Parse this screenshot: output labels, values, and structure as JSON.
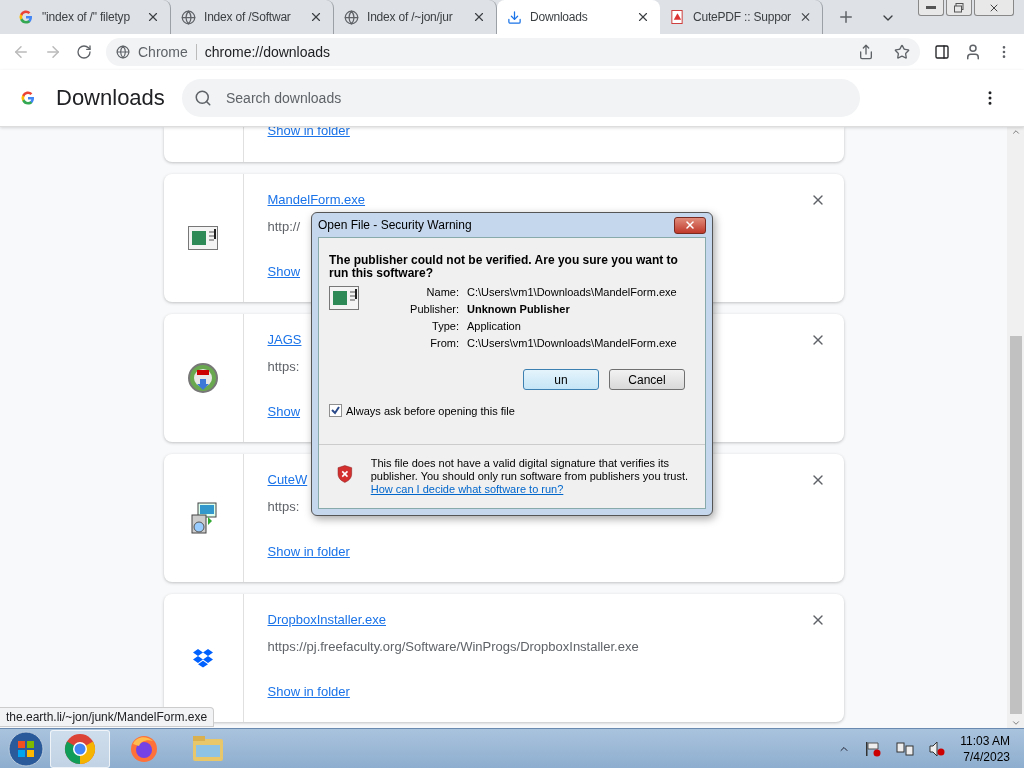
{
  "tabs": [
    {
      "title": "\"index of /\" filetyp",
      "kind": "google",
      "selected": false
    },
    {
      "title": "Index of /Softwar",
      "kind": "globe",
      "selected": false
    },
    {
      "title": "Index of /~jon/jur",
      "kind": "globe",
      "selected": false
    },
    {
      "title": "Downloads",
      "kind": "download",
      "selected": true
    },
    {
      "title": "CutePDF :: Suppor",
      "kind": "pdf",
      "selected": false
    }
  ],
  "address_bar": {
    "site_label": "Chrome",
    "url": "chrome://downloads"
  },
  "header": {
    "title": "Downloads",
    "search": {
      "placeholder": "Search downloads"
    }
  },
  "partial_card": {
    "link": "Show in folder"
  },
  "downloads": [
    {
      "kind": "app",
      "name": "MandelForm.exe",
      "url": "http://",
      "link": "Show"
    },
    {
      "kind": "globe",
      "name": "JAGS",
      "url": "https:",
      "link": "Show"
    },
    {
      "kind": "installer",
      "name": "CuteW",
      "url": "https:",
      "link": "Show in folder"
    },
    {
      "kind": "dropbox",
      "name": "DropboxInstaller.exe",
      "url": "https://pj.freefaculty.org/Software/WinProgs/DropboxInstaller.exe",
      "link": "Show in folder"
    }
  ],
  "status_bubble": "the.earth.li/~jon/junk/MandelForm.exe",
  "dialog": {
    "title": "Open File - Security Warning",
    "heading": "The publisher could not be verified.  Are you sure you want to run this software?",
    "fields": [
      {
        "label": "Name:",
        "value": "C:\\Users\\vm1\\Downloads\\MandelForm.exe",
        "bold": false
      },
      {
        "label": "Publisher:",
        "value": "Unknown Publisher",
        "bold": true
      },
      {
        "label": "Type:",
        "value": "Application",
        "bold": false
      },
      {
        "label": "From:",
        "value": "C:\\Users\\vm1\\Downloads\\MandelForm.exe",
        "bold": false
      }
    ],
    "buttons": [
      {
        "label": "un",
        "default": true
      },
      {
        "label": "Cancel",
        "default": false
      }
    ],
    "checkbox": {
      "label": "Always ask before opening this file",
      "checked": true
    },
    "warning": "This file does not have a valid digital signature that verifies its publisher.  You should only run software from publishers you trust.",
    "help_link": "How can I decide what software to run?"
  },
  "taskbar": {
    "items": [
      {
        "kind": "chrome",
        "selected": true
      },
      {
        "kind": "firefox",
        "selected": false
      },
      {
        "kind": "explorer",
        "selected": false
      }
    ],
    "time": "11:03 AM",
    "date": "7/4/2023"
  }
}
